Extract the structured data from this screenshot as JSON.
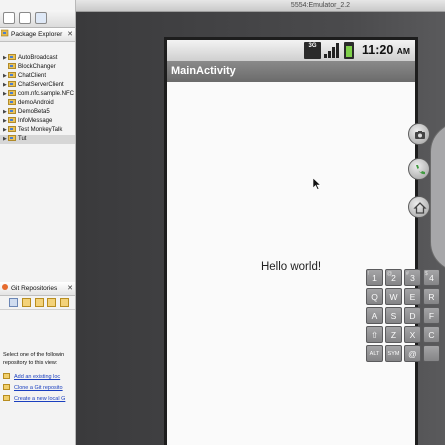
{
  "package_explorer": {
    "title": "Package Explorer",
    "close_icon": "✕",
    "items": [
      {
        "label": "AutoBroadcast",
        "expandable": true
      },
      {
        "label": "BlockChanger",
        "expandable": false
      },
      {
        "label": "ChatClient",
        "expandable": true
      },
      {
        "label": "ChatServerClient",
        "expandable": true
      },
      {
        "label": "com.nfc.sample.NFC",
        "expandable": true
      },
      {
        "label": "demoAndroid",
        "expandable": false
      },
      {
        "label": "DemoBeta5",
        "expandable": true
      },
      {
        "label": "InfoMessage",
        "expandable": true
      },
      {
        "label": "Test MonkeyTalk",
        "expandable": true
      },
      {
        "label": "Tut",
        "expandable": true,
        "selected": true
      }
    ]
  },
  "git_repositories": {
    "title": "Git Repositories",
    "close_icon": "✕",
    "message_line1": "Select one of the followin",
    "message_line2": "repository to this view:",
    "links": [
      "Add an existing loc",
      "Clone a Git reposito",
      "Create a new local G"
    ]
  },
  "emulator": {
    "window_title": "5554:Emulator_2.2",
    "status_bar": {
      "network": "3G",
      "time": "11:20",
      "ampm": "AM",
      "battery_level": 0.8
    },
    "app_title": "MainActivity",
    "content_text": "Hello world!"
  },
  "keyboard": {
    "rows": [
      [
        {
          "label": "1",
          "sup": "!"
        },
        {
          "label": "2",
          "sup": "@"
        },
        {
          "label": "3",
          "sup": "#"
        },
        {
          "label": "4",
          "sup": "$"
        }
      ],
      [
        {
          "label": "Q"
        },
        {
          "label": "W"
        },
        {
          "label": "E"
        },
        {
          "label": "R"
        }
      ],
      [
        {
          "label": "A"
        },
        {
          "label": "S"
        },
        {
          "label": "D"
        },
        {
          "label": "F"
        }
      ],
      [
        {
          "label": "⇧"
        },
        {
          "label": "Z"
        },
        {
          "label": "X"
        },
        {
          "label": "C"
        }
      ],
      [
        {
          "label": "ALT"
        },
        {
          "label": "SYM"
        },
        {
          "label": "@"
        },
        {
          "label": ""
        }
      ]
    ]
  },
  "colors": {
    "selected_row": "#d6d6d6",
    "link": "#1a3fbf",
    "app_bar": "#7a7a7a",
    "battery": "#7fd04a"
  }
}
